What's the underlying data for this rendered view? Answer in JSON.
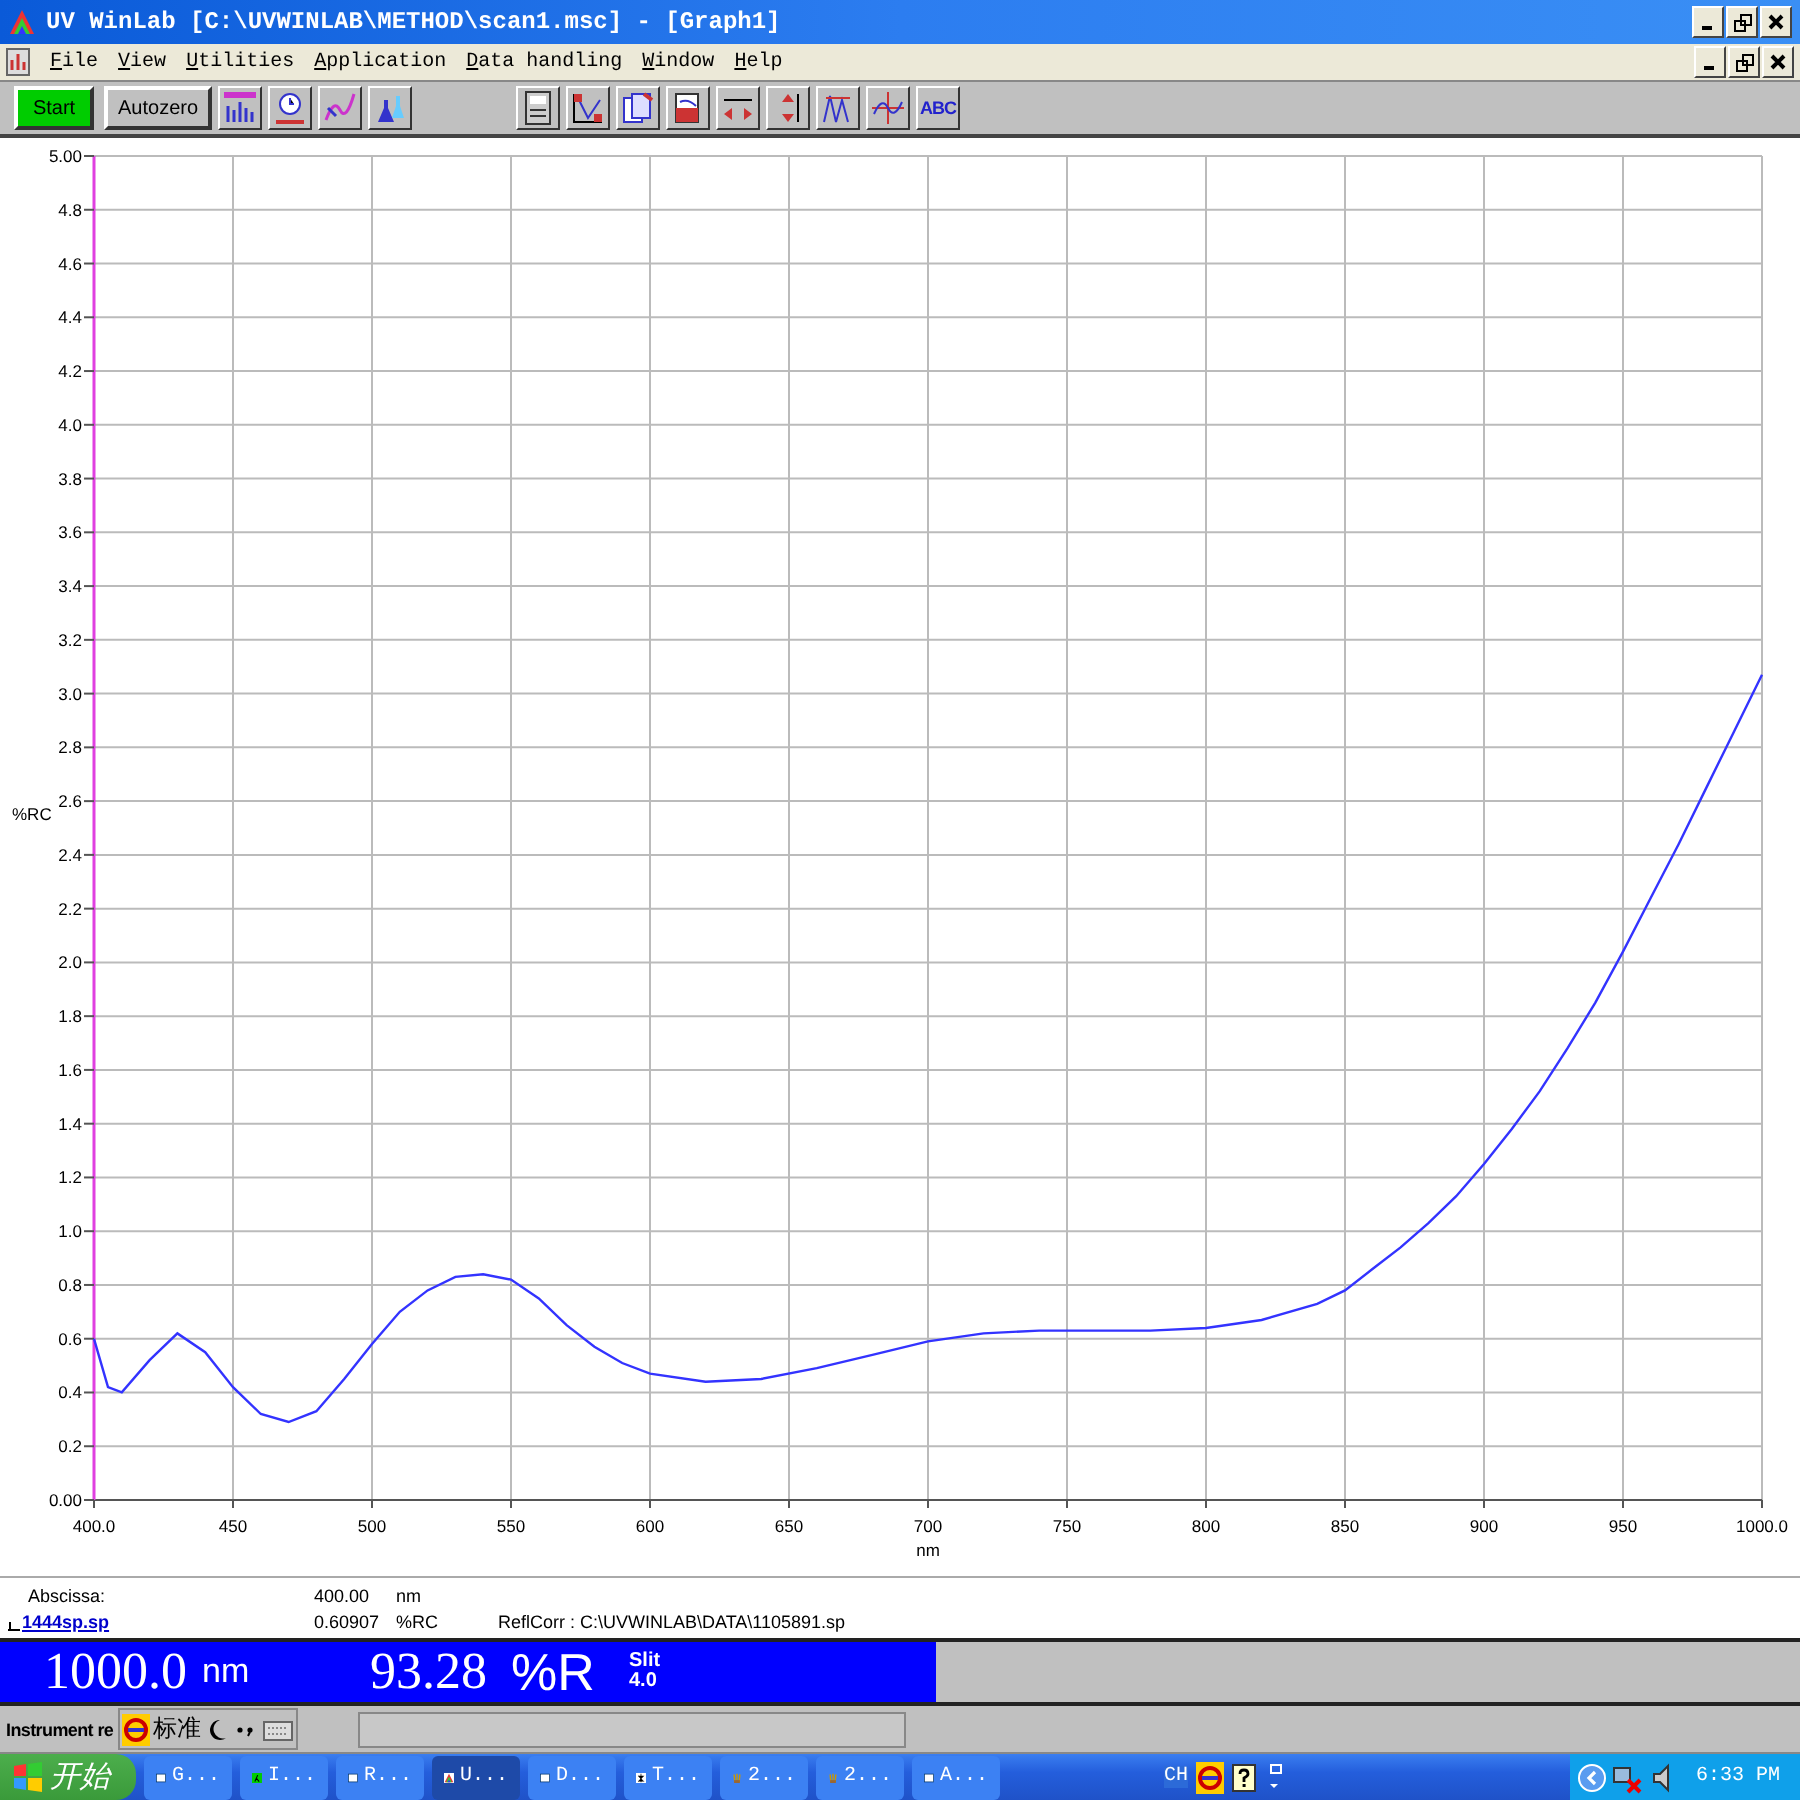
{
  "window": {
    "title": "UV WinLab [C:\\UVWINLAB\\METHOD\\scan1.msc] - [Graph1]"
  },
  "menu": [
    "File",
    "View",
    "Utilities",
    "Application",
    "Data handling",
    "Window",
    "Help"
  ],
  "toolbar": {
    "buttons": [
      {
        "label": "Start",
        "kind": "start"
      },
      {
        "label": "Autozero",
        "kind": "plain"
      }
    ],
    "tools": [
      {
        "kind": "spectrum"
      },
      {
        "kind": "clock"
      },
      {
        "kind": "curve"
      },
      {
        "kind": "flasks"
      }
    ],
    "graph_tools": [
      {
        "kind": "calculator"
      },
      {
        "kind": "plot"
      },
      {
        "kind": "copy"
      },
      {
        "kind": "beaker"
      },
      {
        "kind": "h-arrows"
      },
      {
        "kind": "v-arrows"
      },
      {
        "kind": "peaks"
      },
      {
        "kind": "crosshair"
      },
      {
        "kind": "text",
        "label": "ABC"
      }
    ]
  },
  "graph": {
    "chart_data": {
      "type": "line",
      "grid": true,
      "xlabel": "nm",
      "ylabel": "%RC",
      "xlim": [
        400,
        1000
      ],
      "ylim": [
        0,
        5
      ],
      "xticks": [
        {
          "value": 400,
          "label": "400.0"
        },
        450,
        500,
        550,
        600,
        650,
        700,
        750,
        800,
        850,
        900,
        950,
        {
          "value": 1000,
          "label": "1000.0"
        }
      ],
      "yticks": [
        {
          "value": 0,
          "label": "0.00"
        },
        {
          "value": 0.2,
          "label": "0.2"
        },
        {
          "value": 0.4,
          "label": "0.4"
        },
        {
          "value": 0.6,
          "label": "0.6"
        },
        {
          "value": 0.8,
          "label": "0.8"
        },
        {
          "value": 1,
          "label": "1.0"
        },
        {
          "value": 1.2,
          "label": "1.2"
        },
        {
          "value": 1.4,
          "label": "1.4"
        },
        {
          "value": 1.6,
          "label": "1.6"
        },
        {
          "value": 1.8,
          "label": "1.8"
        },
        {
          "value": 2,
          "label": "2.0"
        },
        {
          "value": 2.2,
          "label": "2.2"
        },
        {
          "value": 2.4,
          "label": "2.4"
        },
        {
          "value": 2.6,
          "label": "2.6"
        },
        {
          "value": 2.8,
          "label": "2.8"
        },
        {
          "value": 3,
          "label": "3.0"
        },
        {
          "value": 3.2,
          "label": "3.2"
        },
        {
          "value": 3.4,
          "label": "3.4"
        },
        {
          "value": 3.6,
          "label": "3.6"
        },
        {
          "value": 3.8,
          "label": "3.8"
        },
        {
          "value": 4,
          "label": "4.0"
        },
        {
          "value": 4.2,
          "label": "4.2"
        },
        {
          "value": 4.4,
          "label": "4.4"
        },
        {
          "value": 4.6,
          "label": "4.6"
        },
        {
          "value": 4.8,
          "label": "4.8"
        },
        {
          "value": 5,
          "label": "5.00"
        }
      ],
      "x": [
        400,
        405,
        410,
        420,
        430,
        440,
        450,
        460,
        470,
        480,
        490,
        500,
        510,
        520,
        530,
        540,
        550,
        560,
        570,
        580,
        590,
        600,
        620,
        640,
        660,
        680,
        700,
        720,
        740,
        760,
        780,
        800,
        820,
        840,
        850,
        860,
        870,
        880,
        890,
        900,
        910,
        920,
        930,
        940,
        950,
        960,
        970,
        980,
        990,
        1000
      ],
      "series": [
        {
          "color": "#3333ff",
          "values": [
            0.6,
            0.42,
            0.4,
            0.52,
            0.62,
            0.55,
            0.42,
            0.32,
            0.29,
            0.33,
            0.45,
            0.58,
            0.7,
            0.78,
            0.83,
            0.84,
            0.82,
            0.75,
            0.65,
            0.57,
            0.51,
            0.47,
            0.44,
            0.45,
            0.49,
            0.54,
            0.59,
            0.62,
            0.63,
            0.63,
            0.63,
            0.64,
            0.67,
            0.73,
            0.78,
            0.86,
            0.94,
            1.03,
            1.13,
            1.25,
            1.38,
            1.52,
            1.68,
            1.85,
            2.04,
            2.24,
            2.44,
            2.65,
            2.86,
            3.07
          ]
        }
      ]
    }
  },
  "info": {
    "abscissa_label": "Abscissa:",
    "abscissa_value": "400.00",
    "abscissa_unit": "nm",
    "file_link": "1444sp.sp",
    "ordinate_value": "0.60907",
    "ordinate_unit": "%RC",
    "reference": "ReflCorr : C:\\UVWINLAB\\DATA\\1105891.sp"
  },
  "readout": {
    "wavelength": "1000.0",
    "wavelength_unit": "nm",
    "value": "93.28",
    "value_unit": "%R",
    "slit_label": "Slit",
    "slit_value": "4.0"
  },
  "status": {
    "label": "Instrument re",
    "ime_mode": "标准"
  },
  "taskbar": {
    "start": "开始",
    "tasks": [
      {
        "label": "G...",
        "kind": "window",
        "selected": false
      },
      {
        "label": "I...",
        "kind": "lambda",
        "selected": false
      },
      {
        "label": "R...",
        "kind": "window",
        "selected": false
      },
      {
        "label": "U...",
        "kind": "rainbow",
        "selected": true
      },
      {
        "label": "D...",
        "kind": "window",
        "selected": false
      },
      {
        "label": "T...",
        "kind": "tool",
        "selected": false
      },
      {
        "label": "2...",
        "kind": "brush",
        "selected": false
      },
      {
        "label": "2...",
        "kind": "brush",
        "selected": false
      },
      {
        "label": "A...",
        "kind": "window",
        "selected": false
      }
    ],
    "tray_language": "CH",
    "clock": "6:33 PM"
  }
}
